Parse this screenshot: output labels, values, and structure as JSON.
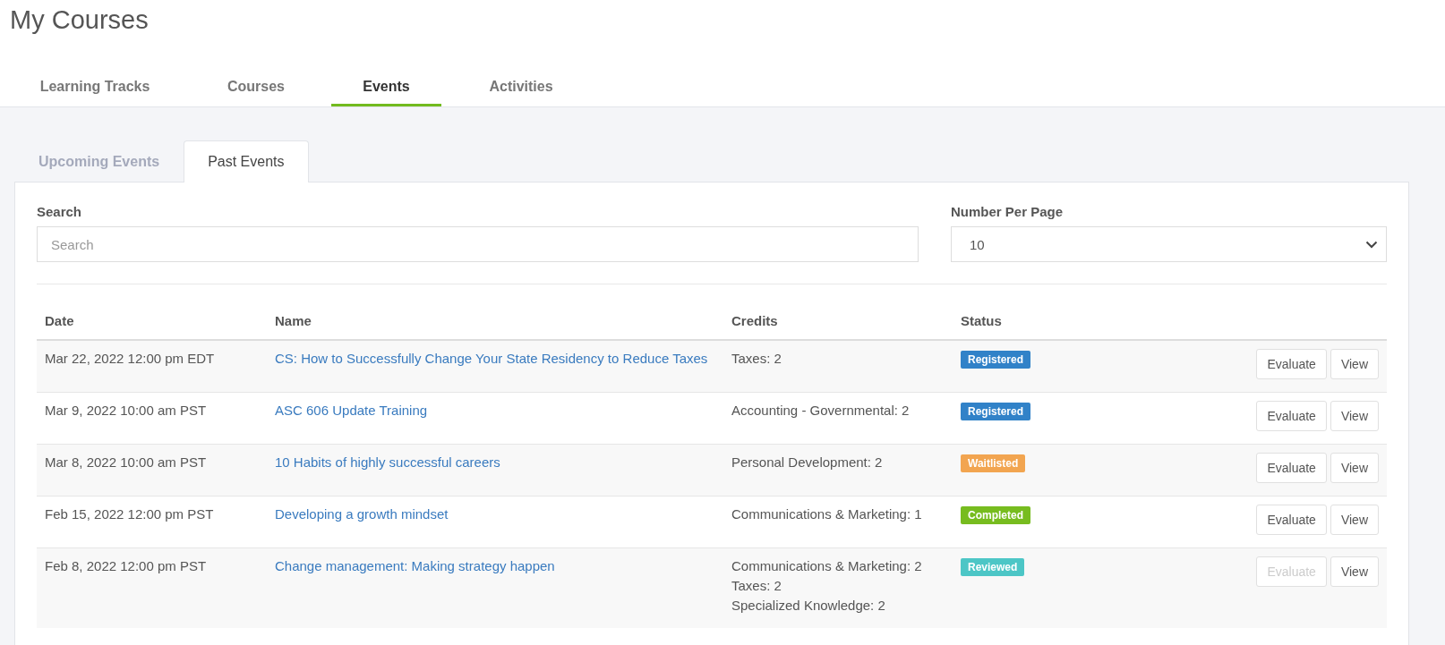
{
  "page_title": "My Courses",
  "tabs": [
    {
      "label": "Learning Tracks",
      "selected": false
    },
    {
      "label": "Courses",
      "selected": false
    },
    {
      "label": "Events",
      "selected": true
    },
    {
      "label": "Activities",
      "selected": false
    }
  ],
  "subtabs": [
    {
      "label": "Upcoming Events",
      "selected": false
    },
    {
      "label": "Past Events",
      "selected": true
    }
  ],
  "search": {
    "label": "Search",
    "placeholder": "Search"
  },
  "per_page": {
    "label": "Number Per Page",
    "value": "10"
  },
  "table": {
    "columns": [
      "Date",
      "Name",
      "Credits",
      "Status"
    ],
    "rows": [
      {
        "date": "Mar 22, 2022 12:00 pm EDT",
        "name": "CS: How to Successfully Change Your State Residency to Reduce Taxes",
        "credits": [
          "Taxes: 2"
        ],
        "status": "Registered",
        "color": "#3182c8",
        "evaluate": "Evaluate",
        "evaluate_disabled": false,
        "view": "View"
      },
      {
        "date": "Mar 9, 2022 10:00 am PST",
        "name": "ASC 606 Update Training",
        "credits": [
          "Accounting - Governmental: 2"
        ],
        "status": "Registered",
        "color": "#3182c8",
        "evaluate": "Evaluate",
        "evaluate_disabled": false,
        "view": "View"
      },
      {
        "date": "Mar 8, 2022 10:00 am PST",
        "name": "10 Habits of highly successful careers",
        "credits": [
          "Personal Development: 2"
        ],
        "status": "Waitlisted",
        "color": "#f2a550",
        "evaluate": "Evaluate",
        "evaluate_disabled": false,
        "view": "View"
      },
      {
        "date": "Feb 15, 2022 12:00 pm PST",
        "name": "Developing a growth mindset",
        "credits": [
          "Communications & Marketing: 1"
        ],
        "status": "Completed",
        "color": "#77bc1f",
        "evaluate": "Evaluate",
        "evaluate_disabled": false,
        "view": "View"
      },
      {
        "date": "Feb 8, 2022 12:00 pm PST",
        "name": "Change management: Making strategy happen",
        "credits": [
          "Communications & Marketing: 2",
          "Taxes: 2",
          "Specialized Knowledge: 2"
        ],
        "status": "Reviewed",
        "color": "#4cc6c6",
        "evaluate": "Evaluate",
        "evaluate_disabled": true,
        "view": "View"
      }
    ]
  }
}
